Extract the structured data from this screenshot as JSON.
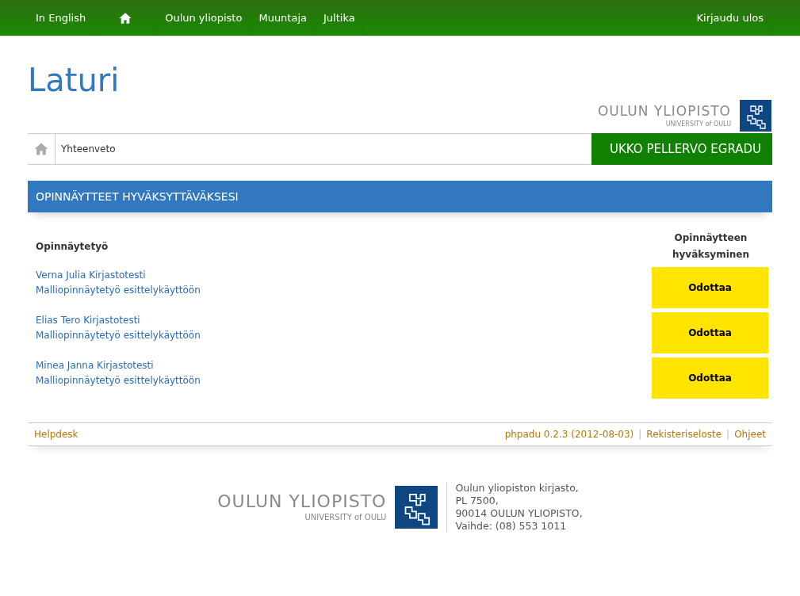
{
  "top_nav": {
    "left": [
      {
        "kind": "link",
        "label": "In English"
      },
      {
        "kind": "home"
      },
      {
        "kind": "link",
        "label": "Oulun yliopisto"
      },
      {
        "kind": "link",
        "label": "Muuntaja"
      },
      {
        "kind": "link",
        "label": "Jultika"
      }
    ],
    "right": [
      {
        "kind": "link",
        "label": "Kirjaudu ulos"
      }
    ]
  },
  "header": {
    "app_title": "Laturi",
    "logo": {
      "name": "OULUN YLIOPISTO",
      "subtitle": "UNIVERSITY of OULU"
    }
  },
  "breadcrumb": {
    "current": "Yhteenveto",
    "user": "UKKO PELLERVO EGRADU"
  },
  "panel": {
    "title": "OPINNÄYTTEET HYVÄKSYTTÄVÄKSESI",
    "columns": [
      "Opinnäytetyö",
      "Opinnäytteen hyväksyminen"
    ],
    "rows": [
      {
        "author": "Verna Julia Kirjastotesti",
        "thesis": "Malliopinnäytetyö esittelykäyttöön",
        "status": "Odottaa"
      },
      {
        "author": "Elias Tero Kirjastotesti",
        "thesis": "Malliopinnäytetyö esittelykäyttöön",
        "status": "Odottaa"
      },
      {
        "author": "Minea Janna Kirjastotesti",
        "thesis": "Malliopinnäytetyö esittelykäyttöön",
        "status": "Odottaa"
      }
    ]
  },
  "footer_bar": {
    "left": [
      {
        "kind": "link",
        "text": "Helpdesk"
      }
    ],
    "right": [
      {
        "kind": "link",
        "text": "phpadu 0.2.3 (2012-08-03)"
      },
      {
        "kind": "sep",
        "text": "|"
      },
      {
        "kind": "link",
        "text": "Rekisteriseloste"
      },
      {
        "kind": "sep",
        "text": "|"
      },
      {
        "kind": "link",
        "text": "Ohjeet"
      }
    ]
  },
  "footer": {
    "logo": {
      "name": "OULUN YLIOPISTO",
      "subtitle": "UNIVERSITY of OULU"
    },
    "address": [
      "Oulun yliopiston kirjasto,",
      "PL 7500,",
      "90014 OULUN YLIOPISTO,",
      "Vaihde: (08) 553 1011"
    ]
  }
}
